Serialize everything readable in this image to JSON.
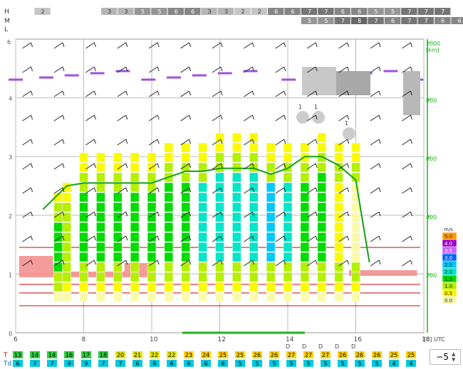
{
  "chart_data": {
    "type": "heatmap",
    "top_cloud_rows": {
      "H": [
        "",
        "2",
        "",
        "",
        "",
        "3",
        "3",
        "5",
        "5",
        "6",
        "6",
        "3",
        "3",
        "2",
        "2",
        "6",
        "6",
        "7",
        "7",
        "6",
        "6",
        "5",
        "5",
        "7",
        "7",
        "7"
      ],
      "M": [
        "",
        "",
        "",
        "",
        "",
        "",
        "",
        "",
        "",
        "",
        "",
        "",
        "",
        "",
        "",
        "",
        "",
        "5",
        "5",
        "7",
        "8",
        "7",
        "6",
        "7",
        "7",
        "6",
        "6"
      ],
      "L": []
    },
    "row_labels": [
      "H",
      "M",
      "L"
    ],
    "x_axis": {
      "ticks": [
        "6",
        "8",
        "10",
        "12",
        "14",
        "16",
        "18"
      ],
      "unit": "[h] UTC",
      "range": [
        6,
        18
      ]
    },
    "y_left": {
      "ticks": [
        "0",
        "1",
        "2",
        "3",
        "4",
        "5"
      ],
      "range": [
        0,
        5.0
      ]
    },
    "y_right": {
      "unit": "[km]",
      "ticks": [
        "200",
        "400",
        "600",
        "800",
        "1000"
      ]
    },
    "colorbar": {
      "unit": "m/s",
      "entries": [
        {
          "label": "5.0",
          "color": "#ff9900"
        },
        {
          "label": "4.0",
          "color": "#a000c8"
        },
        {
          "label": "3.5",
          "color": "#c864ff"
        },
        {
          "label": "3.0",
          "color": "#0064ff"
        },
        {
          "label": "2.5",
          "color": "#00c8ff"
        },
        {
          "label": "2.0",
          "color": "#00e6c8"
        },
        {
          "label": "1.5",
          "color": "#00dc00"
        },
        {
          "label": "1.0",
          "color": "#b4f000"
        },
        {
          "label": "0.5",
          "color": "#fafa00"
        },
        {
          "label": "0.0",
          "color": "#fafaaa"
        }
      ]
    },
    "thermal_columns": {
      "hours": [
        7.25,
        7.5,
        8.0,
        8.5,
        9.0,
        9.5,
        10.0,
        10.5,
        11.0,
        11.5,
        12.0,
        12.5,
        13.0,
        13.5,
        14.0,
        14.5,
        15.0,
        15.5,
        16.0
      ],
      "top_km": [
        2.5,
        2.7,
        3.2,
        3.2,
        3.2,
        3.2,
        3.2,
        3.4,
        3.4,
        3.4,
        3.5,
        3.5,
        3.5,
        3.4,
        3.4,
        3.3,
        3.5,
        3.3,
        3.3
      ],
      "peak_ms": [
        1.5,
        1.0,
        1.5,
        1.5,
        1.5,
        1.5,
        1.5,
        1.5,
        1.5,
        2.0,
        2.0,
        2.0,
        2.0,
        2.5,
        2.0,
        1.5,
        1.5,
        0.5,
        0.0
      ]
    },
    "bl_top_line": {
      "x": [
        6.8,
        7.5,
        8.0,
        9.0,
        10.0,
        10.5,
        11.0,
        11.5,
        12.0,
        12.5,
        13.0,
        13.5,
        14.0,
        14.5,
        15.0,
        15.5,
        16.0,
        16.4
      ],
      "y": [
        2.1,
        2.5,
        2.55,
        2.55,
        2.55,
        2.65,
        2.75,
        2.75,
        2.8,
        2.8,
        2.8,
        2.7,
        2.8,
        3.0,
        3.0,
        2.85,
        2.6,
        1.2
      ]
    },
    "surface_T": [
      "13",
      "14",
      "14",
      "16",
      "17",
      "18",
      "20",
      "21",
      "22",
      "22",
      "23",
      "24",
      "25",
      "25",
      "26",
      "26",
      "27",
      "27",
      "27",
      "26",
      "26",
      "26",
      "25",
      "25"
    ],
    "surface_Td": [
      "6",
      "7",
      "7",
      "9",
      "9",
      "7",
      "7",
      "6",
      "6",
      "6",
      "6",
      "6",
      "6",
      "5",
      "5",
      "5",
      "5",
      "5",
      "5",
      "5",
      "5",
      "5",
      "4",
      "4"
    ],
    "precip_marks": [
      "D",
      "D",
      "D",
      "D",
      "D"
    ],
    "cloud_counts": [
      "1",
      "1",
      "1"
    ],
    "left_top_tick": "6"
  },
  "labels": {
    "T": "T",
    "Td": "Td",
    "H": "H",
    "M": "M",
    "L": "L"
  },
  "spinner": {
    "value": "−5"
  }
}
